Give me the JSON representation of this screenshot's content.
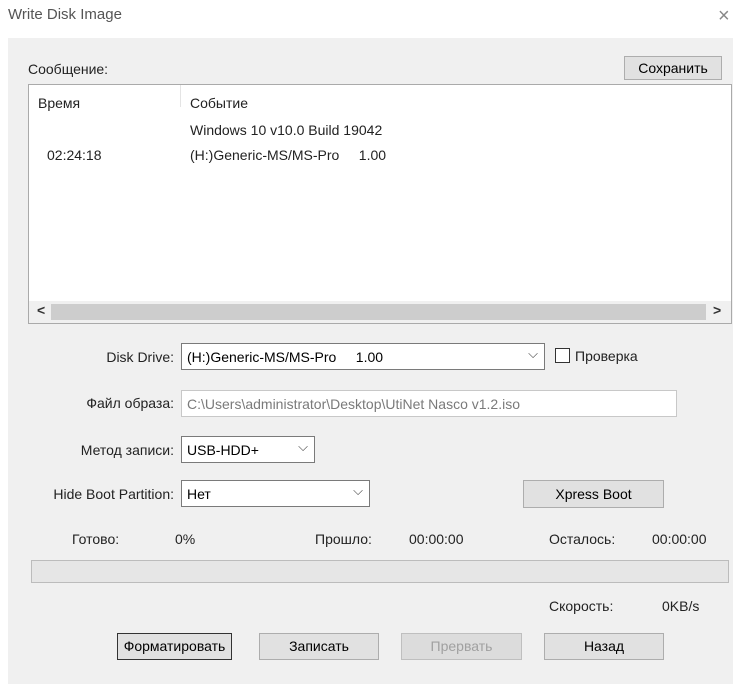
{
  "window": {
    "title": "Write Disk Image",
    "close_glyph": "×"
  },
  "messages": {
    "label": "Сообщение:",
    "save_button": "Сохранить",
    "columns": [
      "Время",
      "Событие"
    ],
    "rows": [
      {
        "time": "",
        "event": "Windows 10 v10.0 Build 19042"
      },
      {
        "time": "02:24:18",
        "event": "(H:)Generic-MS/MS-Pro     1.00"
      }
    ],
    "scroll_left": "<",
    "scroll_right": ">"
  },
  "form": {
    "disk_drive_label": "Disk Drive:",
    "disk_drive_value": "(H:)Generic-MS/MS-Pro     1.00",
    "verify_label": "Проверка",
    "verify_checked": false,
    "image_file_label": "Файл образа:",
    "image_file_value": "C:\\Users\\administrator\\Desktop\\UtiNet Nasco v1.2.iso",
    "write_method_label": "Метод записи:",
    "write_method_value": "USB-HDD+",
    "hide_boot_label": "Hide Boot Partition:",
    "hide_boot_value": "Нет",
    "xpress_boot_button": "Xpress Boot"
  },
  "status": {
    "done_label": "Готово:",
    "done_value": "0%",
    "elapsed_label": "Прошло:",
    "elapsed_value": "00:00:00",
    "remaining_label": "Осталось:",
    "remaining_value": "00:00:00",
    "speed_label": "Скорость:",
    "speed_value": "0KB/s",
    "progress_fraction": 0
  },
  "buttons": {
    "format": "Форматировать",
    "write": "Записать",
    "abort": "Прервать",
    "back": "Назад"
  },
  "icons": {
    "dropdown": "chevron-down-icon",
    "close": "close-icon"
  }
}
